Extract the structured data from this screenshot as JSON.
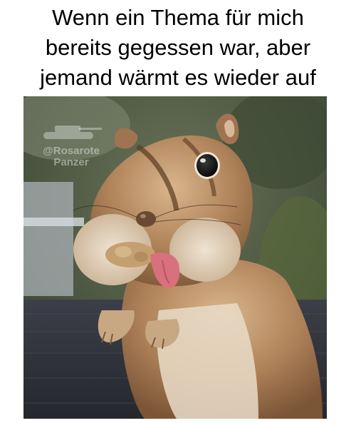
{
  "meme": {
    "caption_lines": [
      "Wenn ein Thema für mich",
      "bereits gegessen war, aber",
      "jemand wärmt es wieder auf"
    ]
  },
  "watermark": {
    "handle": "@Rosarote",
    "name": "Panzer",
    "icon": "tank-icon"
  },
  "photo": {
    "subject": "chipmunk-with-peanut-and-tongue-out",
    "colors": {
      "fur": "#b0835a",
      "background_foliage": "#4c5a3c",
      "table": "#36383f",
      "tongue": "#d9707e"
    }
  }
}
